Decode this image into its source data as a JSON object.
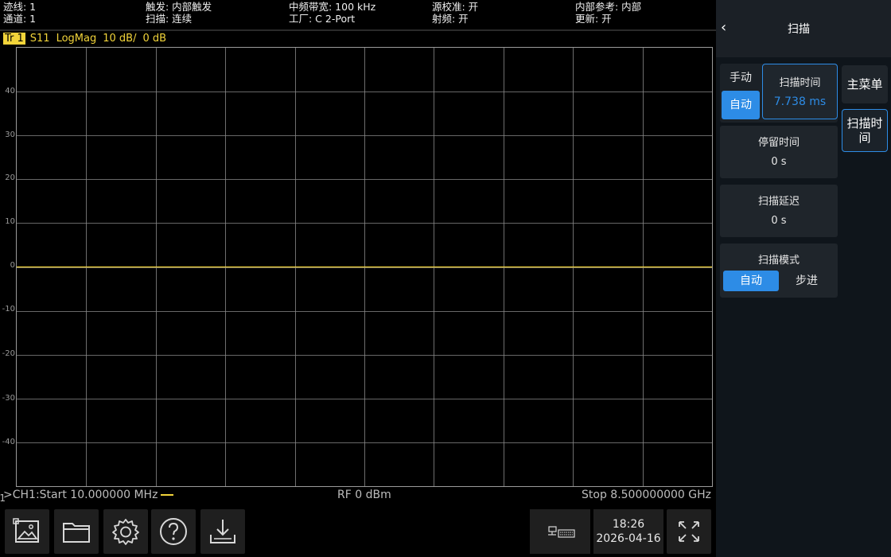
{
  "status": {
    "trace": "迹线: 1",
    "channel": "通道: 1",
    "trigger": "触发: 内部触发",
    "sweep": "扫描: 连续",
    "if_bw": "中频带宽: 100 kHz",
    "factory": "工厂: C 2-Port",
    "source_cal": "源校准: 开",
    "rf": "射频: 开",
    "ref": "内部参考: 内部",
    "update": "更新: 开"
  },
  "trace_header": {
    "tag": "Tr 1",
    "param": "S11",
    "format": "LogMag",
    "scale": "10 dB/",
    "ref": "0 dB"
  },
  "plot": {
    "y_labels": [
      "40",
      "30",
      "20",
      "10",
      "0",
      "-10",
      "-20",
      "-30",
      "-40"
    ],
    "trace_value_db": 0,
    "channel_index": "1"
  },
  "plot_footer": {
    "start": ">CH1:Start 10.000000 MHz",
    "power": "RF 0 dBm",
    "stop": "Stop 8.500000000 GHz"
  },
  "toolbar": {
    "icons": [
      "screenshot-icon",
      "folder-icon",
      "settings-icon",
      "help-icon",
      "save-icon"
    ],
    "time": "18:26",
    "date": "2026-04-16"
  },
  "panel": {
    "back": "‹",
    "title": "扫描",
    "sweep_time_mode": {
      "manual": "手动",
      "auto": "自动",
      "selected": "auto"
    },
    "sweep_time": {
      "label": "扫描时间",
      "value": "7.738 ms"
    },
    "dwell_time": {
      "label": "停留时间",
      "value": "0 s"
    },
    "sweep_delay": {
      "label": "扫描延迟",
      "value": "0 s"
    },
    "sweep_mode": {
      "label": "扫描模式",
      "auto": "自动",
      "step": "步进",
      "selected": "auto"
    },
    "tabs": {
      "main_menu": "主菜单",
      "sweep_time": "扫描时间"
    }
  },
  "colors": {
    "trace": "#f2d43a",
    "accent": "#2d8ce6",
    "grid": "#8a8a8a"
  }
}
